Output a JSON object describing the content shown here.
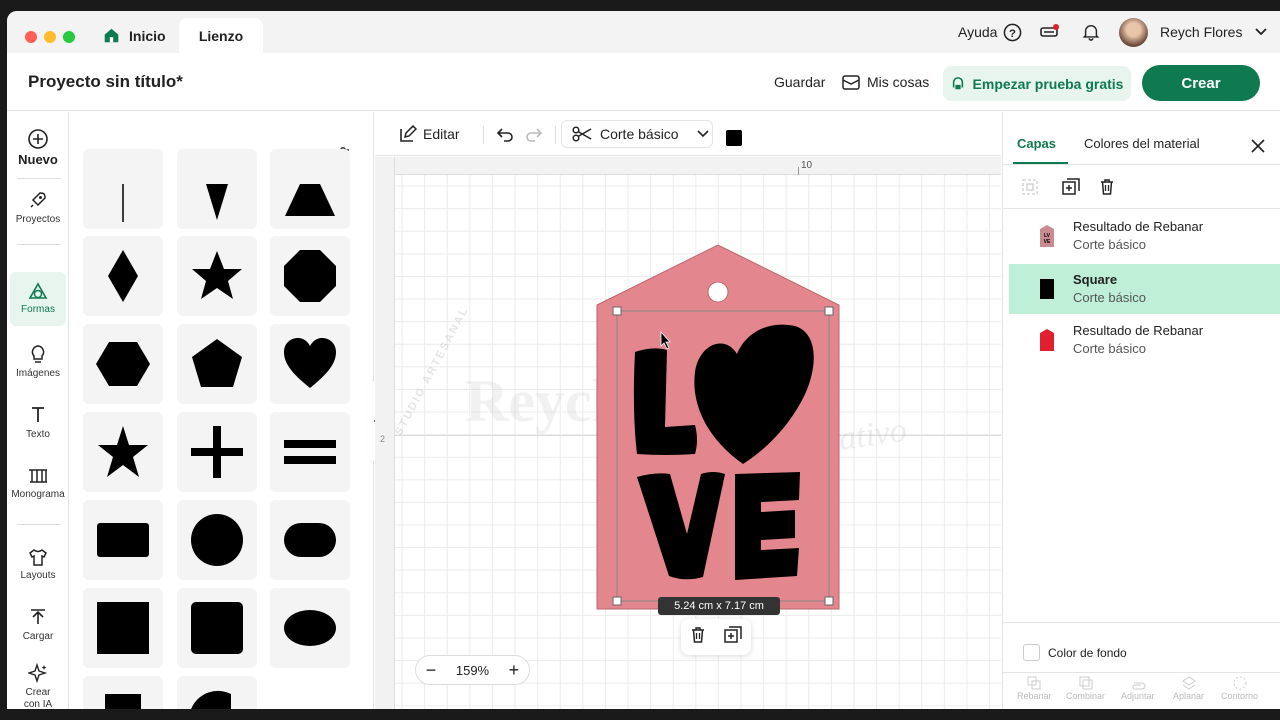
{
  "titlebar": {
    "tabs": [
      {
        "label": "Inicio"
      },
      {
        "label": "Lienzo"
      }
    ],
    "help_label": "Ayuda",
    "user_name": "Reych Flores"
  },
  "header": {
    "project_title": "Proyecto sin título*",
    "save_label": "Guardar",
    "my_stuff_label": "Mis cosas",
    "trial_label": "Empezar prueba gratis",
    "create_label": "Crear"
  },
  "leftnav": {
    "items": [
      {
        "label": "Nuevo",
        "icon": "plus-circle-icon"
      },
      {
        "label": "Proyectos",
        "icon": "rocket-icon"
      },
      {
        "label": "Formas",
        "icon": "shapes-icon"
      },
      {
        "label": "Imágenes",
        "icon": "lightbulb-icon"
      },
      {
        "label": "Texto",
        "icon": "text-icon"
      },
      {
        "label": "Monograma",
        "icon": "monogram-icon"
      },
      {
        "label": "Layouts",
        "icon": "shirt-icon"
      },
      {
        "label": "Cargar",
        "icon": "upload-icon"
      },
      {
        "label": "Crear con IA",
        "icon": "sparkle-icon"
      }
    ]
  },
  "toolbar": {
    "edit_label": "Editar",
    "operation_label": "Corte básico",
    "color": "#000000"
  },
  "canvas": {
    "ruler_mark": "10",
    "size_label": "5.24  cm x 7.17  cm",
    "zoom_label": "159%",
    "tag_color": "#e3868d",
    "tag_text_top": "L",
    "tag_text_bottom": "VE",
    "watermark_top": "STUDIO ARTESANAL",
    "watermark_main": "Reych Flores",
    "watermark_script": "Estudio creativo"
  },
  "right_panel": {
    "tabs": [
      {
        "label": "Capas"
      },
      {
        "label": "Colores del material"
      }
    ],
    "layers": [
      {
        "name": "Resultado de Rebanar",
        "op": "Corte básico",
        "color": "#c98a92"
      },
      {
        "name": "Square",
        "op": "Corte básico",
        "color": "#000000"
      },
      {
        "name": "Resultado de Rebanar",
        "op": "Corte básico",
        "color": "#e0202e"
      }
    ],
    "bg_color_label": "Color de fondo",
    "bottom_actions": [
      "Rebanar",
      "Combinar",
      "Adjuntar",
      "Aplanar",
      "Contorno"
    ]
  },
  "colors": {
    "brand": "#0f7a4f",
    "brand_light": "#e7f5ee",
    "selected_layer": "#bff0d7"
  }
}
